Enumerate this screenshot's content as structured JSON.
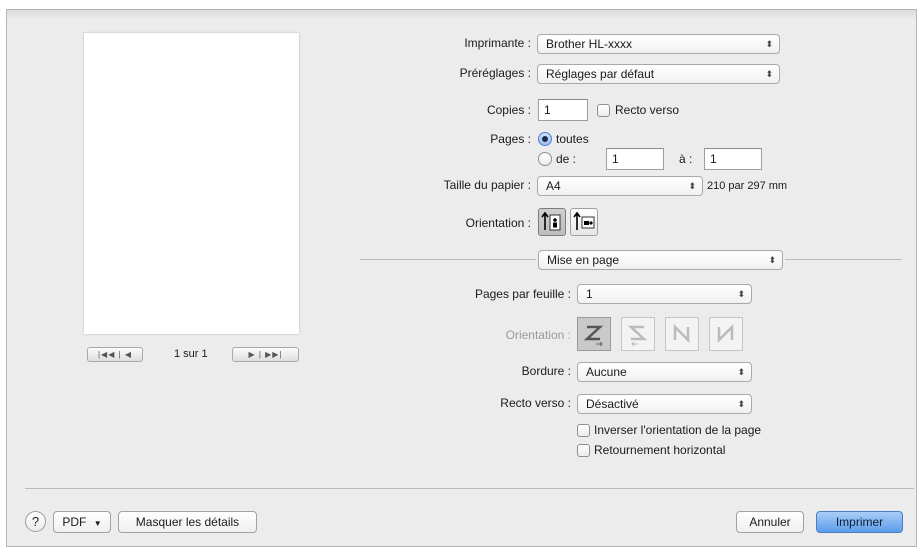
{
  "printer": {
    "label": "Imprimante :",
    "value": "Brother HL-xxxx"
  },
  "presets": {
    "label": "Préréglages :",
    "value": "Réglages par défaut"
  },
  "copies": {
    "label": "Copies :",
    "value": "1",
    "duplex_label": "Recto verso"
  },
  "pages": {
    "label": "Pages :",
    "all_label": "toutes",
    "from_label": "de :",
    "from_value": "1",
    "to_label": "à :",
    "to_value": "1"
  },
  "paper_size": {
    "label": "Taille du papier :",
    "value": "A4",
    "dimensions": "210 par 297 mm"
  },
  "orientation": {
    "label": "Orientation :"
  },
  "section_popup": {
    "value": "Mise en page"
  },
  "layout": {
    "pages_per_sheet_label": "Pages par feuille :",
    "pages_per_sheet_value": "1",
    "orientation_label": "Orientation :",
    "border_label": "Bordure :",
    "border_value": "Aucune",
    "two_sided_label": "Recto verso :",
    "two_sided_value": "Désactivé",
    "reverse_label": "Inverser l'orientation de la page",
    "flip_label": "Retournement horizontal"
  },
  "preview": {
    "page_counter": "1 sur 1"
  },
  "footer": {
    "help": "?",
    "pdf": "PDF",
    "hide_details": "Masquer les détails",
    "cancel": "Annuler",
    "print": "Imprimer"
  },
  "colors": {
    "accent": "#5d9ce9",
    "background": "#ececec"
  }
}
